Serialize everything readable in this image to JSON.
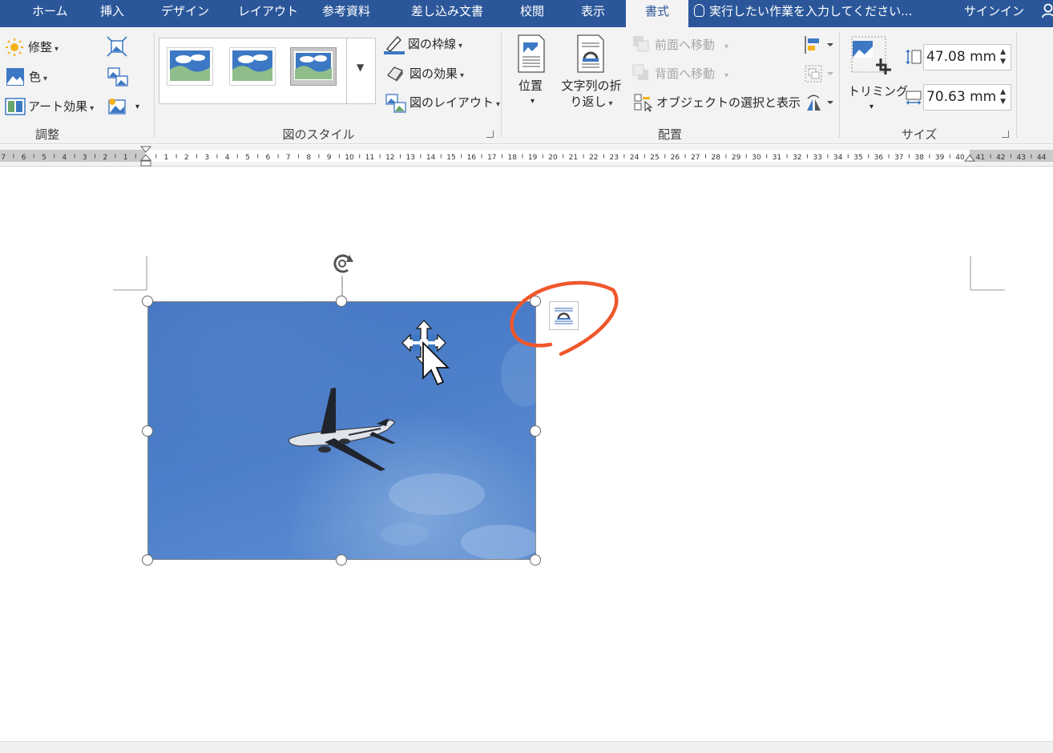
{
  "tabs": [
    {
      "label": "ホーム"
    },
    {
      "label": "挿入"
    },
    {
      "label": "デザイン"
    },
    {
      "label": "レイアウト"
    },
    {
      "label": "参考資料"
    },
    {
      "label": "差し込み文書"
    },
    {
      "label": "校閲"
    },
    {
      "label": "表示"
    },
    {
      "label": "書式",
      "active": true
    }
  ],
  "tell_me": {
    "placeholder": "実行したい作業を入力してください..."
  },
  "signin": {
    "label": "サインイン"
  },
  "ribbon": {
    "adjust": {
      "label": "調整",
      "corrections": "修整",
      "color": "色",
      "artistic_effects": "アート効果"
    },
    "styles": {
      "label": "図のスタイル",
      "border": "図の枠線",
      "effects": "図の効果",
      "layout": "図のレイアウト"
    },
    "arrange": {
      "label": "配置",
      "position": "位置",
      "wrap_text_line1": "文字列の折",
      "wrap_text_line2": "り返し",
      "bring_forward": "前面へ移動",
      "send_backward": "背面へ移動",
      "selection_pane": "オブジェクトの選択と表示"
    },
    "size": {
      "label": "サイズ",
      "crop": "トリミング",
      "height": "47.08 mm",
      "width": "70.63 mm"
    }
  },
  "ruler": {
    "left_numbers": [
      "7",
      "6",
      "5",
      "4",
      "3",
      "2",
      "1"
    ],
    "right_numbers": [
      "1",
      "2",
      "3",
      "4",
      "5",
      "6",
      "7",
      "8",
      "9",
      "10",
      "11",
      "12",
      "13",
      "14",
      "15",
      "16",
      "17",
      "18",
      "19",
      "20",
      "21",
      "22",
      "23",
      "24",
      "25",
      "26",
      "27",
      "28",
      "29",
      "30",
      "31",
      "32",
      "33",
      "34",
      "35",
      "36",
      "37",
      "38",
      "39",
      "40",
      "41",
      "42",
      "43",
      "44"
    ]
  },
  "colors": {
    "ribbon_blue": "#2b579a",
    "ribbon_bg": "#f3f3f3",
    "highlight_circle": "#f0572c",
    "sky": "#4a7cc6"
  }
}
